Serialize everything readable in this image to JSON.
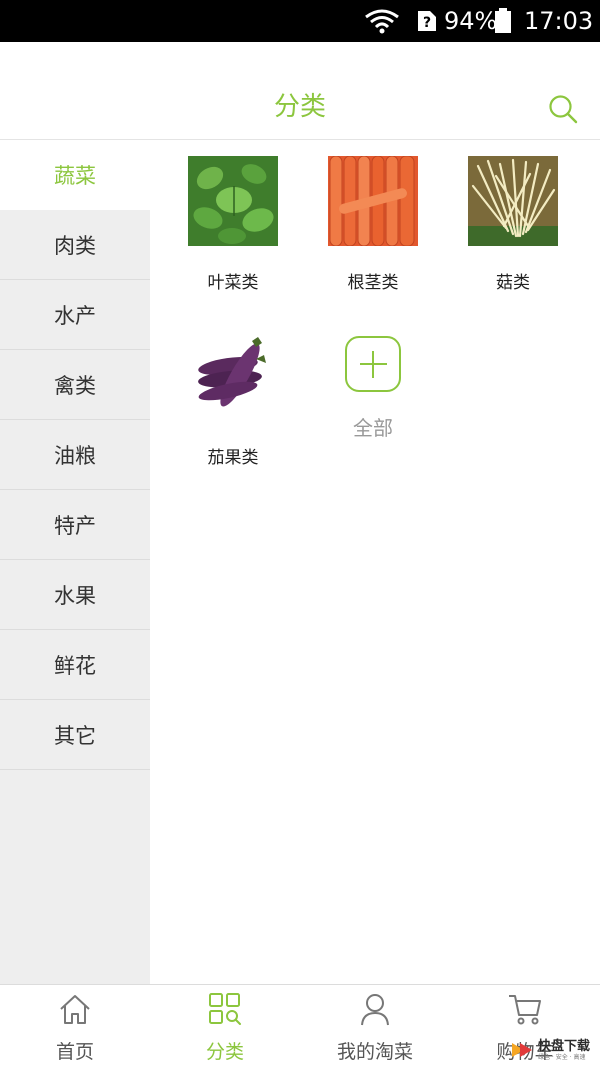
{
  "status_bar": {
    "battery_percent": "94%",
    "time": "17:03"
  },
  "header": {
    "title": "分类"
  },
  "sidebar": {
    "items": [
      {
        "label": "蔬菜",
        "active": true
      },
      {
        "label": "肉类",
        "active": false
      },
      {
        "label": "水产",
        "active": false
      },
      {
        "label": "禽类",
        "active": false
      },
      {
        "label": "油粮",
        "active": false
      },
      {
        "label": "特产",
        "active": false
      },
      {
        "label": "水果",
        "active": false
      },
      {
        "label": "鲜花",
        "active": false
      },
      {
        "label": "其它",
        "active": false
      }
    ]
  },
  "categories": [
    {
      "label": "叶菜类",
      "image": "mint-leaves"
    },
    {
      "label": "根茎类",
      "image": "carrots"
    },
    {
      "label": "菇类",
      "image": "enoki-mushrooms"
    },
    {
      "label": "茄果类",
      "image": "eggplants"
    }
  ],
  "all_button": {
    "label": "全部",
    "icon": "plus-icon"
  },
  "bottom_nav": [
    {
      "label": "首页",
      "icon": "home-icon",
      "active": false
    },
    {
      "label": "分类",
      "icon": "category-grid-icon",
      "active": true
    },
    {
      "label": "我的淘菜",
      "icon": "user-icon",
      "active": false
    },
    {
      "label": "购物车",
      "icon": "cart-icon",
      "active": false
    }
  ],
  "watermark": {
    "text": "快盘下载",
    "subtext": "绿色 · 安全 · 高速"
  },
  "colors": {
    "accent": "#8cc63e",
    "sidebar_bg": "#eeeeee",
    "status_bar_bg": "#000000"
  }
}
